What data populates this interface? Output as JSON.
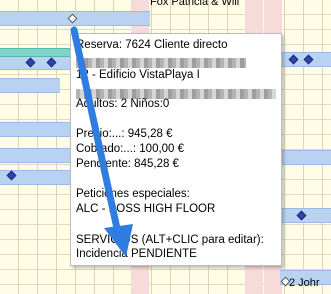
{
  "calendar": {
    "top_guest_label": "Fox Patricia & Will",
    "bottom_guest_label": "2 Johr"
  },
  "tooltip": {
    "reservation": "Reserva: 7624 Cliente directo",
    "unit": "12 - Edificio VistaPlaya I",
    "guests": "Adultos: 2  Niños:0",
    "price": "Precio:...: 945,28 €",
    "collected": "Cobrado:...: 100,00 €",
    "pending": "Pendiente: 845,28 €",
    "special_requests_title": "Peticiones especiales:",
    "special_requests_value": "ALC  -  POSS HIGH FLOOR",
    "services_title": "SERVICIOS (ALT+CLIC para editar):",
    "services_value": "Incidencia PENDIENTE"
  },
  "colors": {
    "arrow": "#2f7de0",
    "booking_bar": "#b9d2f2",
    "teal_bar": "#7fd6c8",
    "weekend_column": "#f7dada"
  },
  "icons": [
    "booking-marker-icon",
    "annotation-arrow-icon"
  ]
}
